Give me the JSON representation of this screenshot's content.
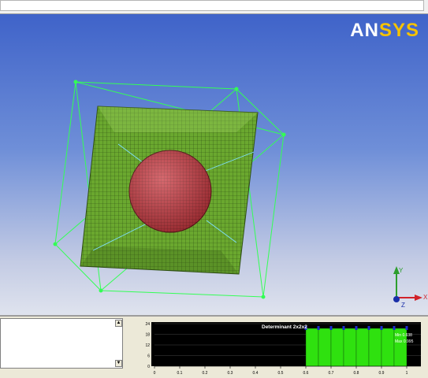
{
  "logo": {
    "text_main": "AN",
    "text_accent": "SYS"
  },
  "histogram": {
    "title": "Determinant 2x2x2",
    "min_label": "Min 0.638",
    "max_label": "Max 0.995",
    "y_ticks": [
      "24",
      "18",
      "12",
      "6",
      "0"
    ],
    "x_ticks": [
      "0",
      "0.1",
      "0.2",
      "0.3",
      "0.4",
      "0.5",
      "0.6",
      "0.7",
      "0.8",
      "0.9",
      "1"
    ]
  },
  "triad": {
    "y_label": "Y",
    "x_label": "X",
    "z_label": "Z"
  },
  "colors": {
    "box_mesh": "#6aa82f",
    "sphere": "#c9373f",
    "wire": "#33ff55",
    "hist_bar": "#2fe10f",
    "hist_bg": "#000000"
  }
}
